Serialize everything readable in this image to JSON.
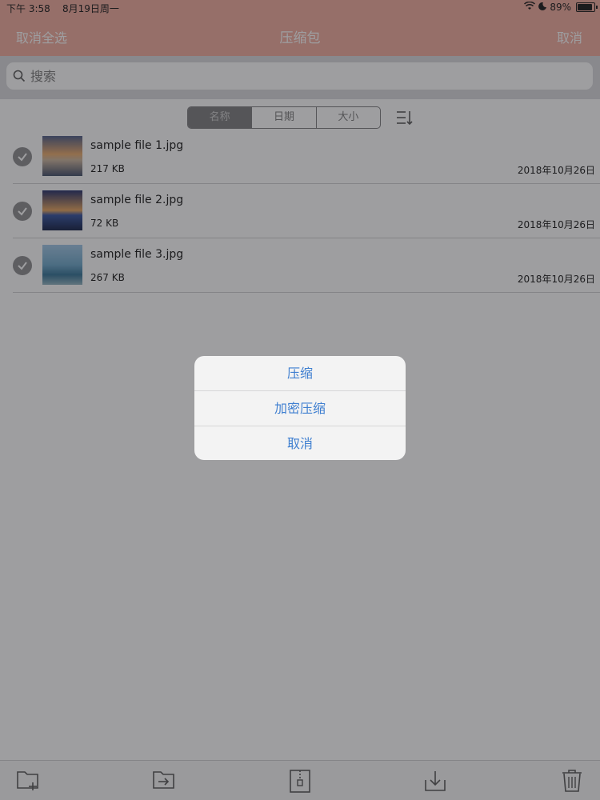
{
  "status_bar": {
    "time": "下午 3:58",
    "date": "8月19日周一",
    "battery": "89%",
    "battery_level": 0.89
  },
  "nav": {
    "left_label": "取消全选",
    "title": "压缩包",
    "right_label": "取消"
  },
  "search": {
    "placeholder": "搜索"
  },
  "sort_tabs": [
    "名称",
    "日期",
    "大小"
  ],
  "files": [
    {
      "name": "sample file 1.jpg",
      "size": "217 KB",
      "date": "2018年10月26日"
    },
    {
      "name": "sample file 2.jpg",
      "size": "72 KB",
      "date": "2018年10月26日"
    },
    {
      "name": "sample file 3.jpg",
      "size": "267 KB",
      "date": "2018年10月26日"
    }
  ],
  "action_sheet": {
    "items": [
      "压缩",
      "加密压缩",
      "取消"
    ]
  },
  "toolbar": {
    "icons": [
      "new-folder-icon",
      "move-icon",
      "zip-icon",
      "download-icon",
      "trash-icon"
    ]
  },
  "colors": {
    "nav_bar": "#f0a99b",
    "accent": "#3f7fd0"
  }
}
